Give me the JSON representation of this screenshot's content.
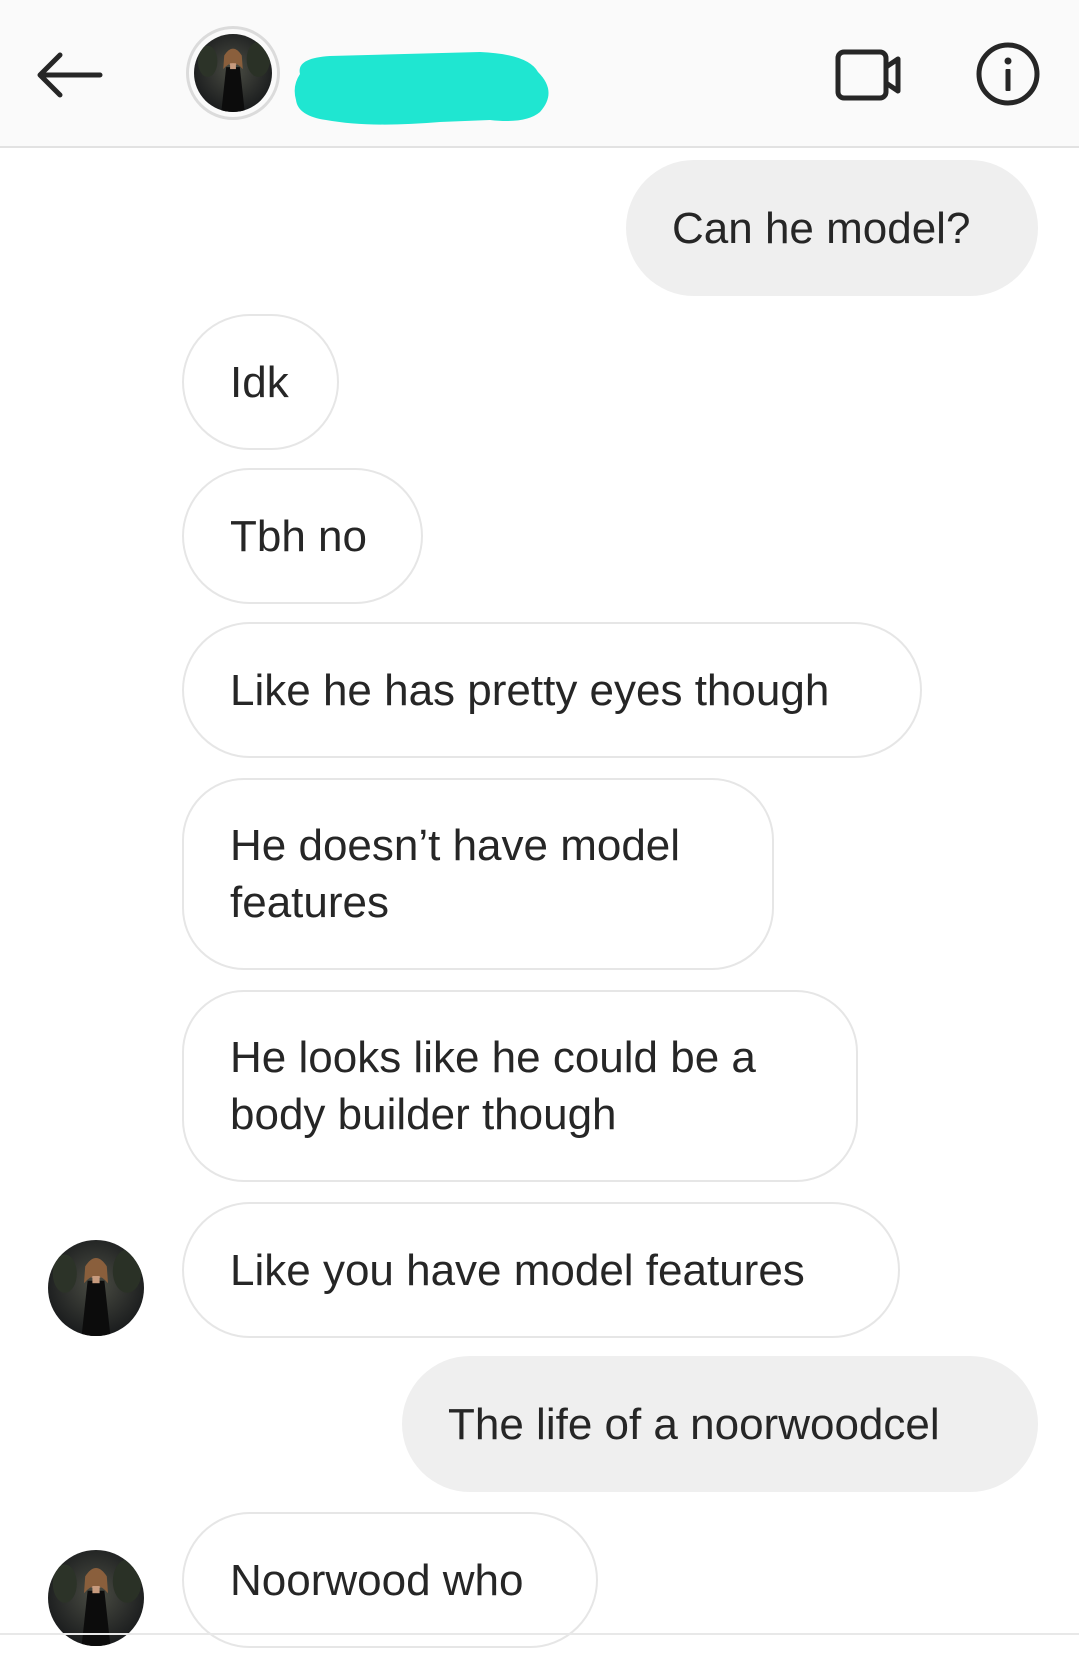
{
  "header": {
    "back_icon": "arrow-left-icon",
    "video_icon": "video-camera-icon",
    "info_icon": "info-icon",
    "redaction_color": "#1fe6d1"
  },
  "messages": [
    {
      "side": "sent",
      "text": "Can he model?"
    },
    {
      "side": "received",
      "text": "Idk"
    },
    {
      "side": "received",
      "text": "Tbh no"
    },
    {
      "side": "received",
      "text": "Like he has pretty eyes though"
    },
    {
      "side": "received",
      "text": "He doesn’t have model features"
    },
    {
      "side": "received",
      "text": "He looks like he could be a body builder though"
    },
    {
      "side": "received",
      "text": "Like you have model features"
    },
    {
      "side": "sent",
      "text": "The life of a noorwoodcel"
    },
    {
      "side": "received",
      "text": "Noorwood who"
    }
  ],
  "colors": {
    "sent_bubble": "#efefef",
    "received_border": "#e6e6e6",
    "header_bg": "#fafafa",
    "text": "#262626"
  }
}
